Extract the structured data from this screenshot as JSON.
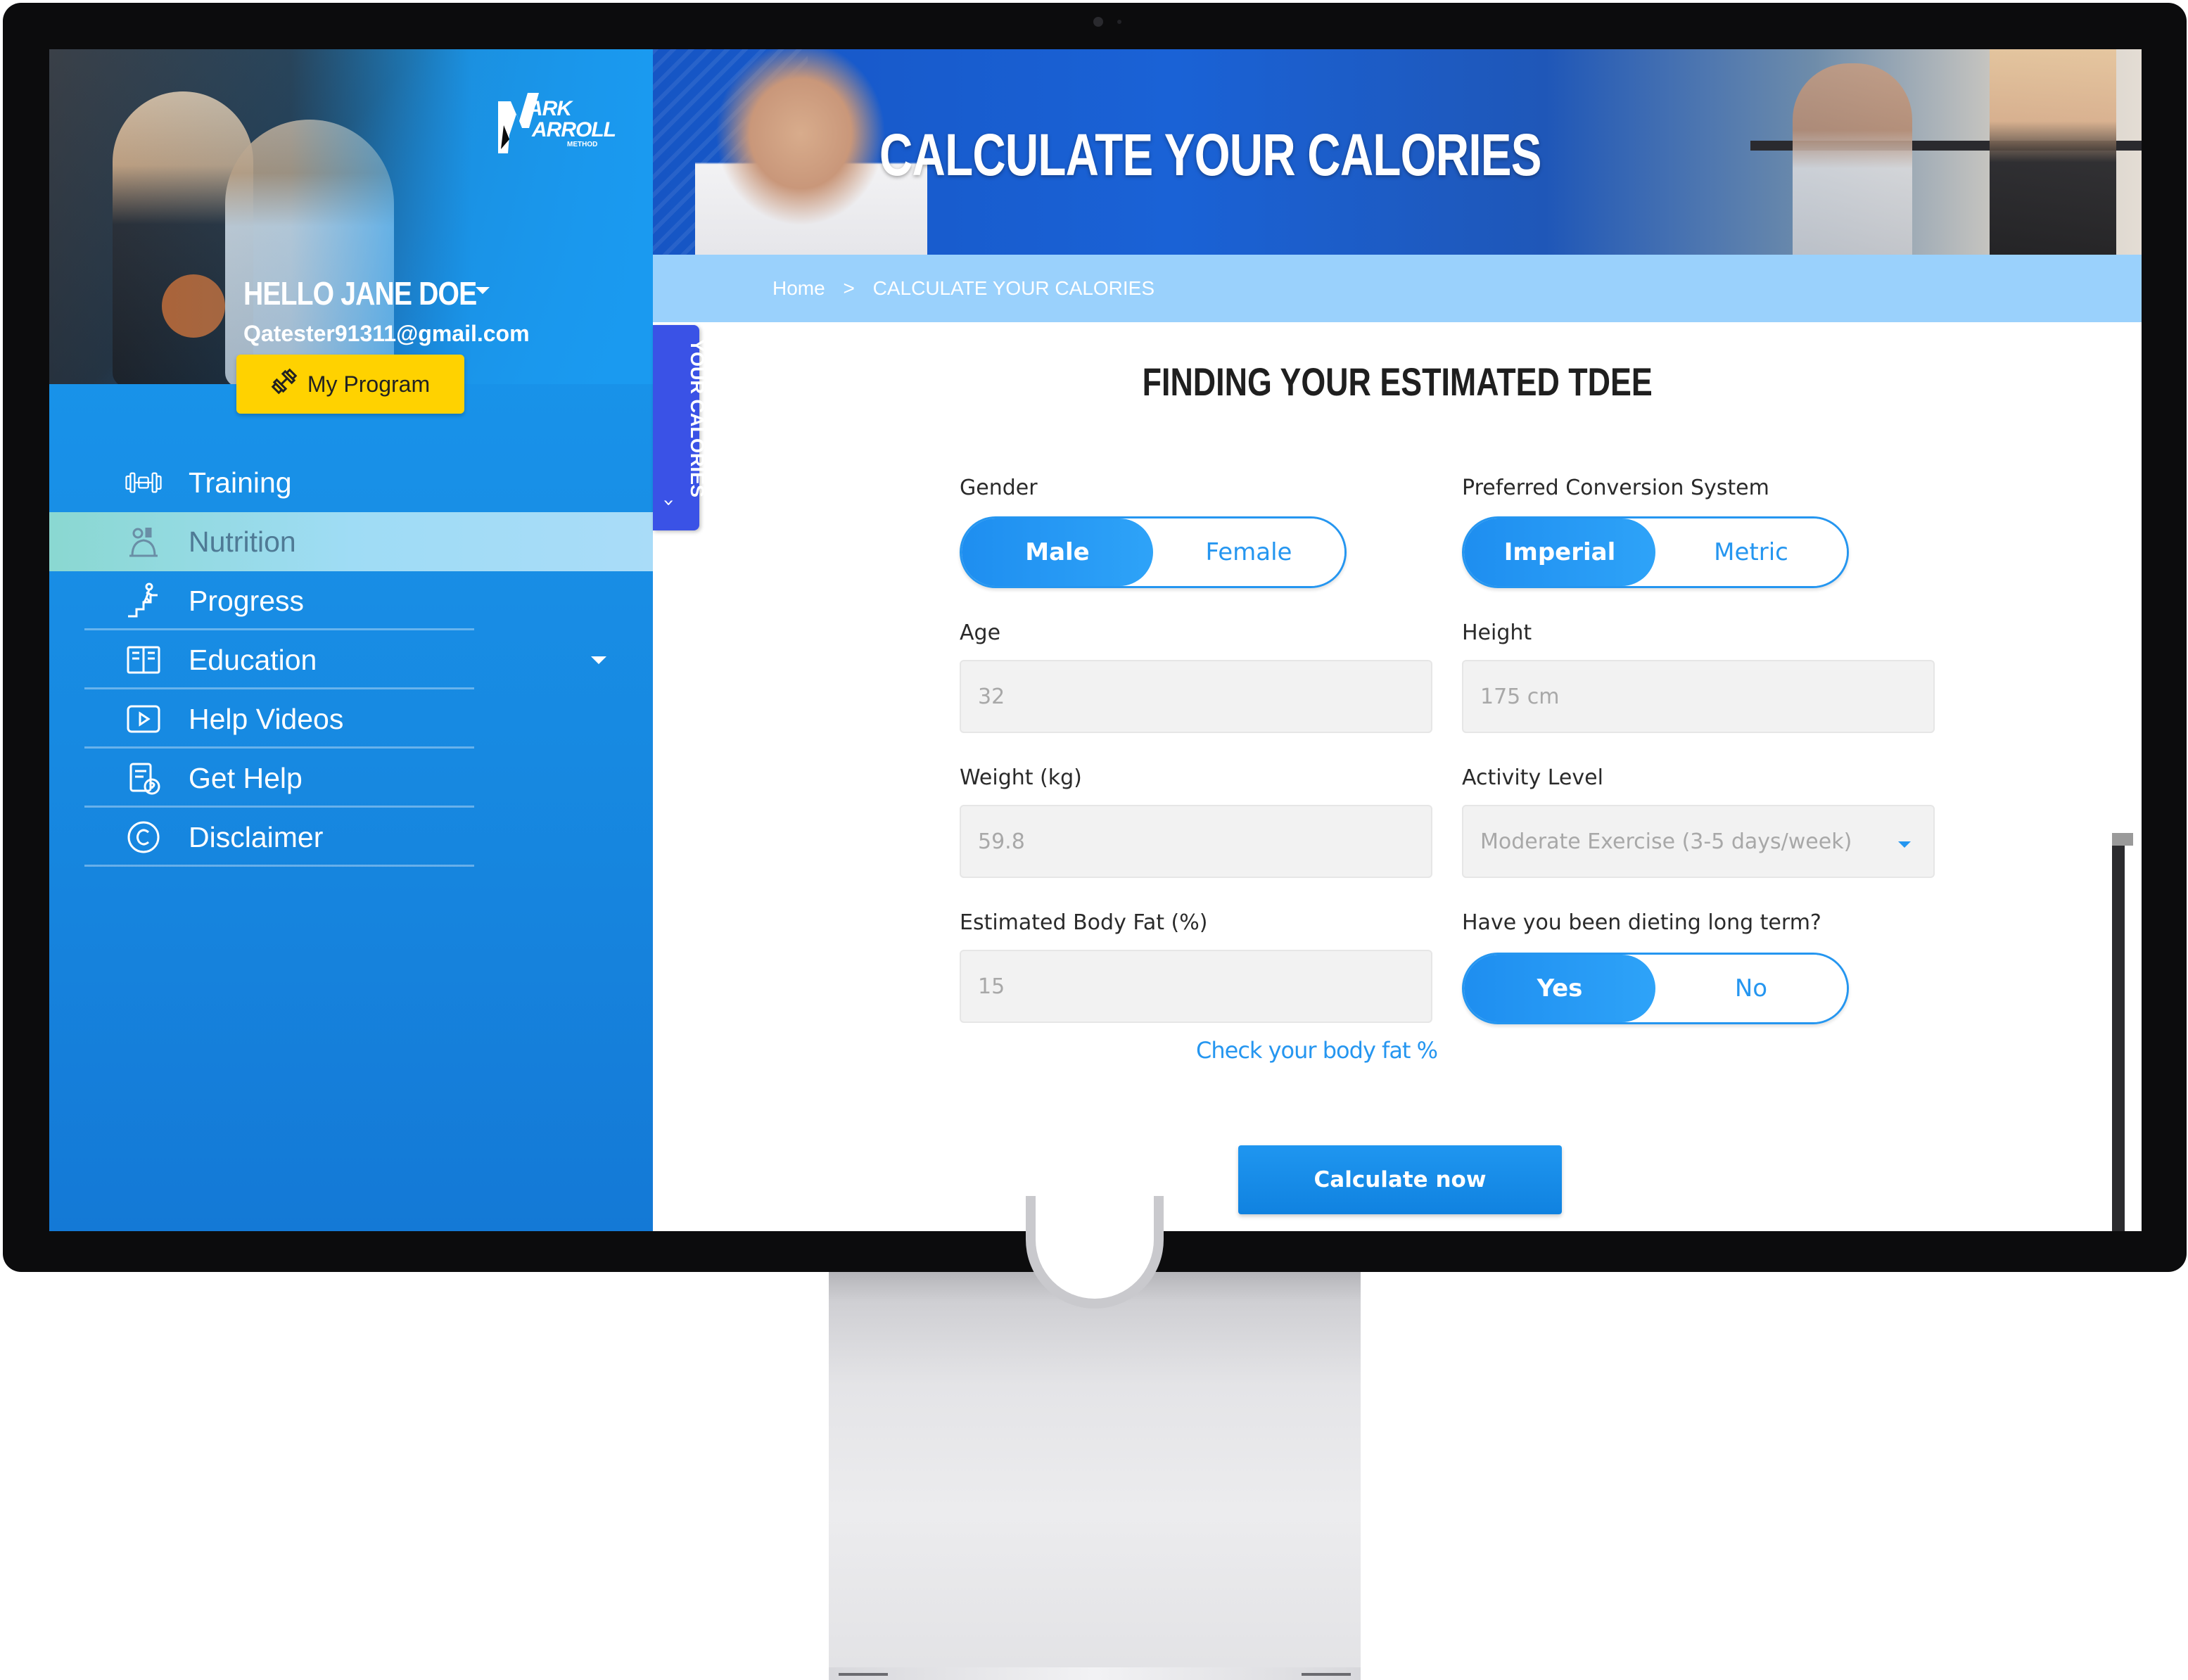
{
  "brand": {
    "logo_line1": "ARK",
    "logo_line2": "ARROLL",
    "logo_line3": "METHOD"
  },
  "user": {
    "greeting": "HELLO JANE DOE",
    "email": "Qatester91311@gmail.com",
    "program_button": "My Program"
  },
  "nav": {
    "items": [
      {
        "label": "Training",
        "icon": "dumbbell-icon"
      },
      {
        "label": "Nutrition",
        "icon": "nutrition-icon"
      },
      {
        "label": "Progress",
        "icon": "progress-stairs-icon"
      },
      {
        "label": "Education",
        "icon": "book-icon"
      },
      {
        "label": "Help Videos",
        "icon": "play-icon"
      },
      {
        "label": "Get Help",
        "icon": "help-clipboard-icon"
      },
      {
        "label": "Disclaimer",
        "icon": "copyright-icon"
      }
    ],
    "active": "Nutrition"
  },
  "hero": {
    "title": "CALCULATE YOUR CALORIES"
  },
  "breadcrumb": {
    "home": "Home",
    "separator": ">",
    "current": "CALCULATE YOUR CALORIES"
  },
  "side_tab": {
    "label": "YOUR CALORIES"
  },
  "form": {
    "title": "FINDING YOUR ESTIMATED TDEE",
    "gender": {
      "label": "Gender",
      "options": [
        "Male",
        "Female"
      ],
      "selected": "Male"
    },
    "conversion": {
      "label": "Preferred Conversion System",
      "options": [
        "Imperial",
        "Metric"
      ],
      "selected": "Imperial"
    },
    "age": {
      "label": "Age",
      "placeholder": "32"
    },
    "height": {
      "label": "Height",
      "placeholder": "175 cm"
    },
    "weight": {
      "label": "Weight (kg)",
      "placeholder": "59.8"
    },
    "activity": {
      "label": "Activity Level",
      "value": "Moderate Exercise (3-5 days/week)"
    },
    "body_fat": {
      "label": "Estimated Body Fat (%)",
      "placeholder": "15"
    },
    "body_fat_link": "Check your body fat %",
    "dieting": {
      "label": "Have you been dieting long term?",
      "options": [
        "Yes",
        "No"
      ],
      "selected": "Yes"
    },
    "submit": "Calculate now"
  },
  "colors": {
    "accent": "#2596f0",
    "sidebar": "#1a9af0",
    "program_button": "#ffd200",
    "side_tab": "#3a52e6"
  }
}
